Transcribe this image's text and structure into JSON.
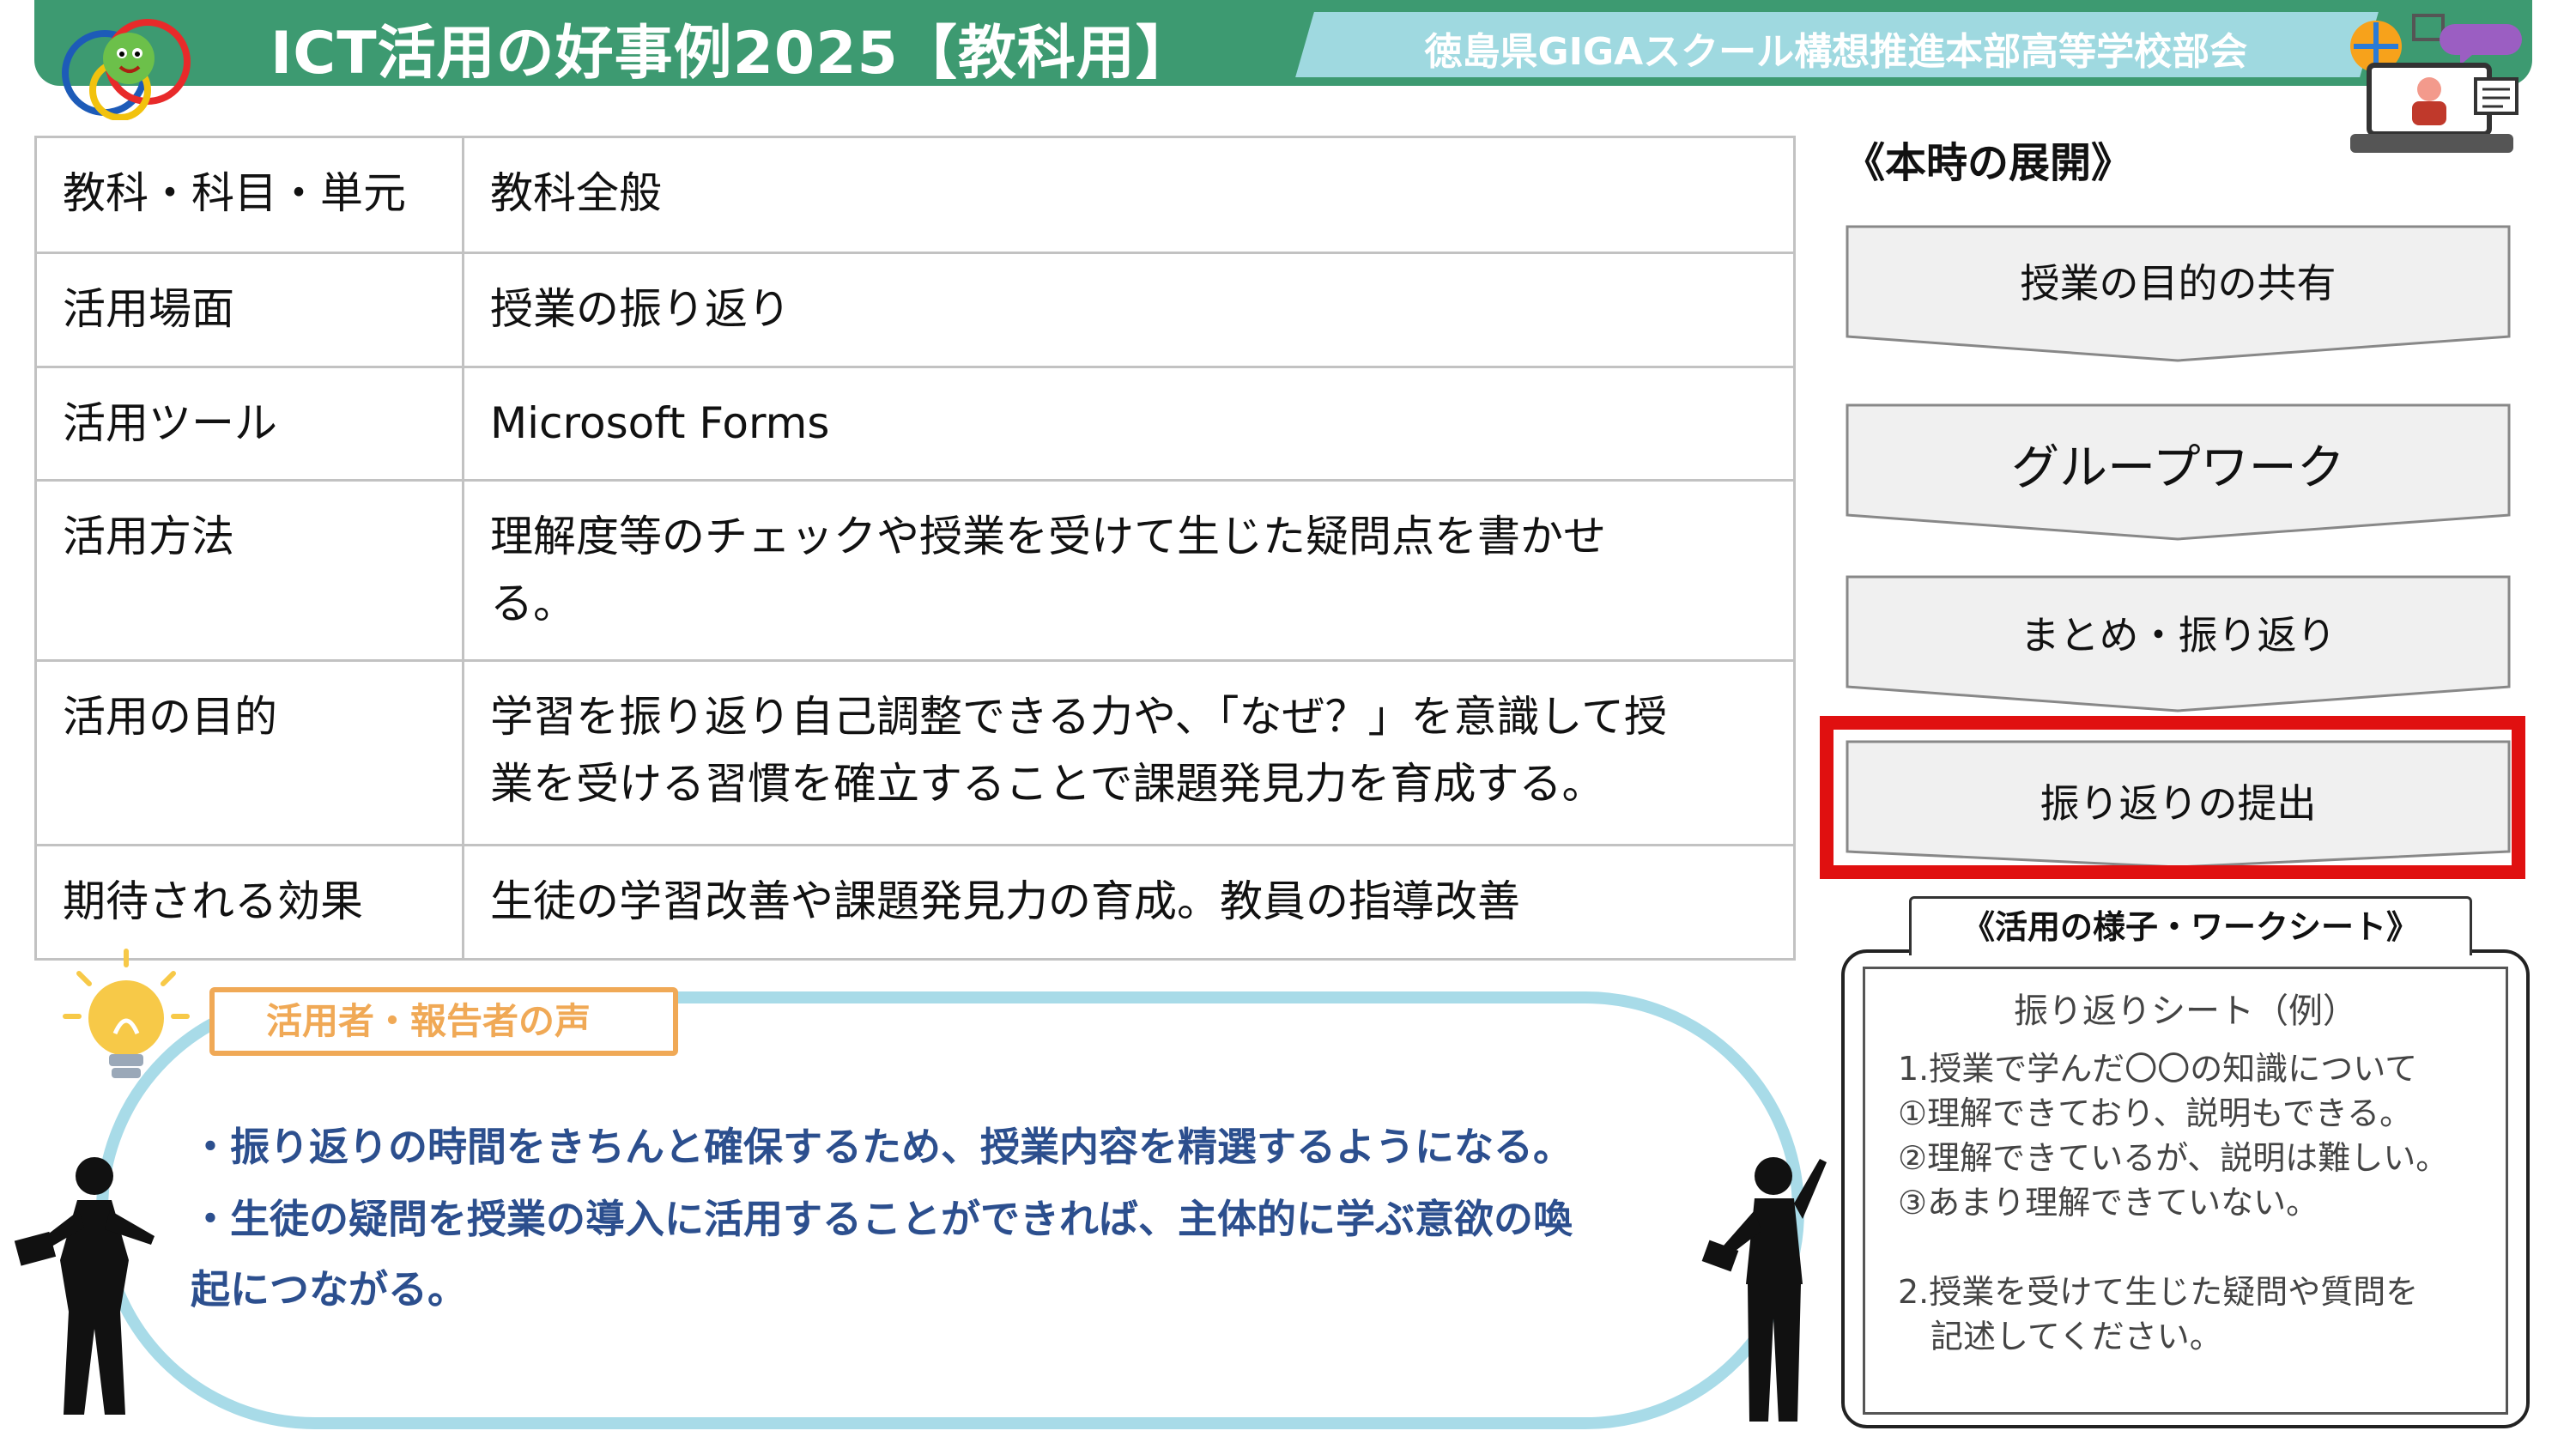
{
  "header": {
    "title": "ICT活用の好事例2025【教科用】",
    "org": "徳島県GIGAスクール構想推進本部高等学校部会"
  },
  "info_rows": [
    {
      "label": "教科・科目・単元",
      "lines": [
        "教科全般"
      ]
    },
    {
      "label": "活用場面",
      "lines": [
        "授業の振り返り"
      ]
    },
    {
      "label": "活用ツール",
      "lines": [
        "Microsoft Forms"
      ]
    },
    {
      "label": "活用方法",
      "lines": [
        "理解度等のチェックや授業を受けて生じた疑問点を書かせ",
        "る。"
      ]
    },
    {
      "label": "活用の目的",
      "lines": [
        "学習を振り返り自己調整できる力や、「なぜ？」を意識して授",
        "業を受ける習慣を確立することで課題発見力を育成する。"
      ]
    },
    {
      "label": "期待される効果",
      "lines": [
        "生徒の学習改善や課題発見力の育成。教員の指導改善"
      ]
    }
  ],
  "flow": {
    "title": "《本時の展開》",
    "steps": [
      "授業の目的の共有",
      "グループワーク",
      "まとめ・振り返り",
      "振り返りの提出"
    ],
    "highlighted_index": 3,
    "highlight_color": "#e01010"
  },
  "worksheet": {
    "tab_label": "《活用の様子・ワークシート》",
    "title": "振り返りシート（例）",
    "body": "1.授業で学んだ〇〇の知識について\n①理解できており、説明もできる。\n②理解できているが、説明は難しい。\n③あまり理解できていない。\n\n2.授業を受けて生じた疑問や質問を\n　記述してください。"
  },
  "voice": {
    "label": "活用者・報告者の声",
    "lines": [
      "・振り返りの時間をきちんと確保するため、授業内容を精選するようになる。",
      "・生徒の疑問を授業の導入に活用することができれば、主体的に学ぶ意欲の喚",
      "起につながる。"
    ]
  },
  "colors": {
    "header_green": "#3d9a71",
    "header_org_bg": "#9fd9e0",
    "voice_text": "#2c4f8e",
    "voice_label": "#f0a956",
    "bubble_border": "#a8dbe8"
  }
}
